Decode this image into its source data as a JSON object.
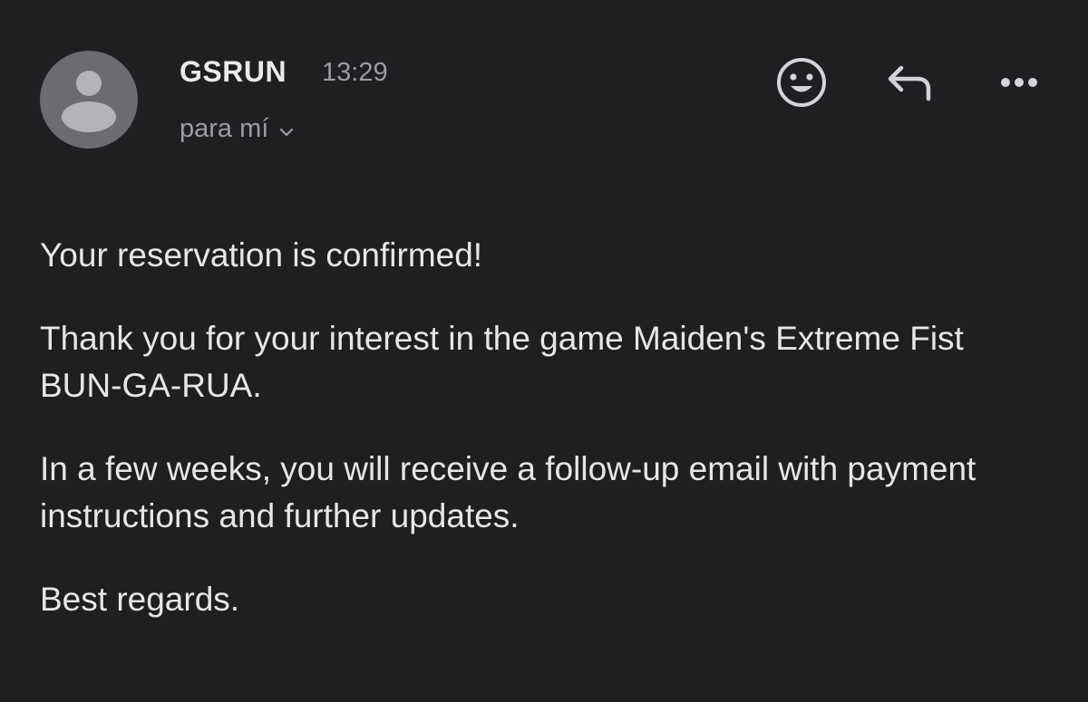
{
  "email": {
    "sender": "GSRUN",
    "time": "13:29",
    "recipient": "para mí",
    "actions": {
      "react_icon": "smiley-face-icon",
      "reply_icon": "reply-arrow-icon",
      "more_icon": "more-horizontal-icon"
    },
    "body": {
      "headline": "Your reservation is confirmed!",
      "paragraph_1": "Thank you for your interest in the game Maiden's Extreme Fist BUN-GA-RUA.",
      "paragraph_2": "In a few weeks, you will receive a follow-up email with payment instructions and further updates.",
      "closing": "Best regards."
    }
  },
  "colors": {
    "background": "#1f1f21",
    "primary_text": "#e6e6e8",
    "secondary_text": "#9c9ca1",
    "avatar": "#6b6b70"
  }
}
